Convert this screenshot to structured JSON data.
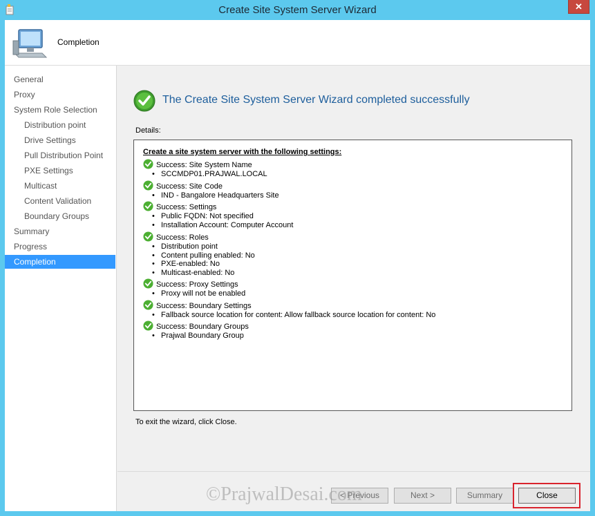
{
  "window": {
    "title": "Create Site System Server Wizard",
    "close_glyph": "✕"
  },
  "header": {
    "title": "Completion"
  },
  "nav": {
    "items": [
      {
        "label": "General",
        "sub": false,
        "active": false
      },
      {
        "label": "Proxy",
        "sub": false,
        "active": false
      },
      {
        "label": "System Role Selection",
        "sub": false,
        "active": false
      },
      {
        "label": "Distribution point",
        "sub": true,
        "active": false
      },
      {
        "label": "Drive Settings",
        "sub": true,
        "active": false
      },
      {
        "label": "Pull Distribution Point",
        "sub": true,
        "active": false
      },
      {
        "label": "PXE Settings",
        "sub": true,
        "active": false
      },
      {
        "label": "Multicast",
        "sub": true,
        "active": false
      },
      {
        "label": "Content Validation",
        "sub": true,
        "active": false
      },
      {
        "label": "Boundary Groups",
        "sub": true,
        "active": false
      },
      {
        "label": "Summary",
        "sub": false,
        "active": false
      },
      {
        "label": "Progress",
        "sub": false,
        "active": false
      },
      {
        "label": "Completion",
        "sub": false,
        "active": true
      }
    ]
  },
  "main": {
    "success_message": "The Create Site System Server Wizard completed successfully",
    "details_label": "Details:",
    "details_heading": "Create a site system server with the following settings:",
    "sections": [
      {
        "title": "Success: Site System Name",
        "items": [
          "SCCMDP01.PRAJWAL.LOCAL"
        ]
      },
      {
        "title": "Success: Site Code",
        "items": [
          "IND - Bangalore Headquarters Site"
        ]
      },
      {
        "title": "Success: Settings",
        "items": [
          "Public FQDN: Not specified",
          "Installation Account: Computer Account"
        ]
      },
      {
        "title": "Success: Roles",
        "items": [
          "Distribution point",
          "Content pulling enabled: No",
          "PXE-enabled: No",
          "Multicast-enabled: No"
        ]
      },
      {
        "title": "Success: Proxy Settings",
        "items": [
          "Proxy will not be enabled"
        ]
      },
      {
        "title": "Success: Boundary Settings",
        "items": [
          "Fallback source location for content: Allow fallback source location for content: No"
        ]
      },
      {
        "title": "Success: Boundary Groups",
        "items": [
          "Prajwal Boundary Group"
        ]
      }
    ],
    "exit_text": "To exit the wizard, click Close."
  },
  "footer": {
    "previous_label": "< Previous",
    "next_label": "Next >",
    "summary_label": "Summary",
    "close_label": "Close"
  },
  "watermark": "©PrajwalDesai.com",
  "colors": {
    "title_bar": "#5cc9ee",
    "nav_active": "#3399ff",
    "success_text": "#1d5e9c",
    "highlight": "#d9232d"
  }
}
